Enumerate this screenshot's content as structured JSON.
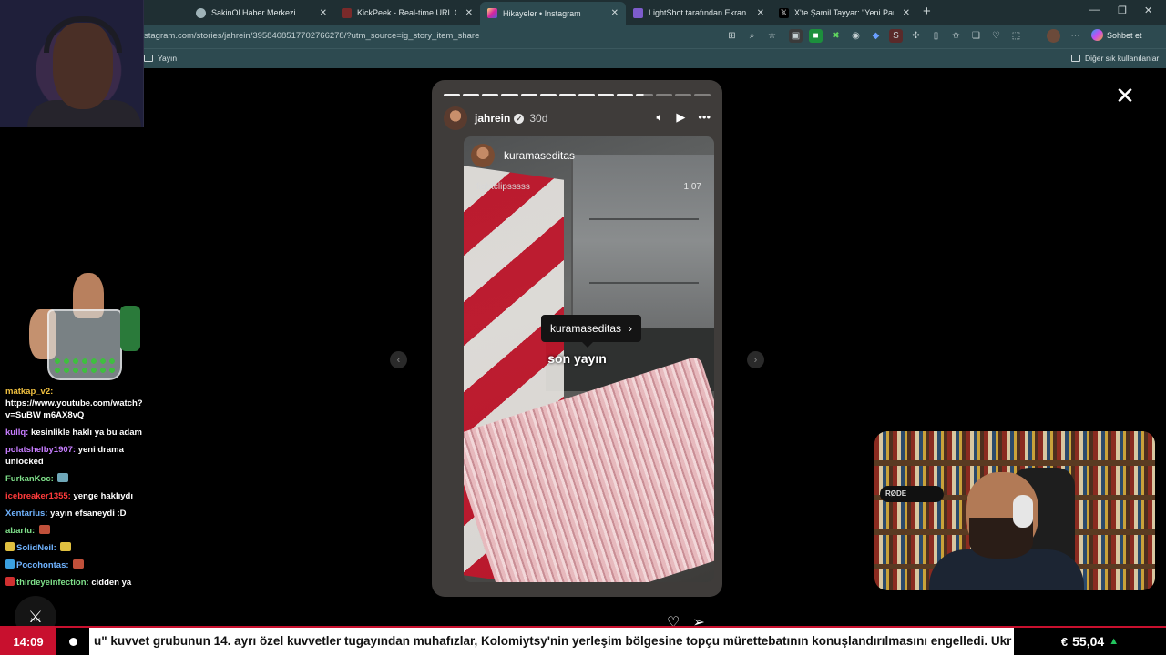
{
  "browser": {
    "tabs": [
      {
        "label": "SakinOl Haber Merkezi",
        "icon": "globe-icon",
        "color": "#9fb3b8"
      },
      {
        "label": "KickPeek - Real-time URL Crawler",
        "icon": "kickpeek-icon",
        "color": "#7a2a2a"
      },
      {
        "label": "Hikayeler • Instagram",
        "icon": "instagram-icon",
        "color": "#d6249f"
      },
      {
        "label": "LightShot tarafından Ekran Görüntüsü",
        "icon": "lightshot-icon",
        "color": "#7d5ccc"
      },
      {
        "label": "X'te Şamil Tayyar: \"Yeni Parti Genel",
        "icon": "x-icon",
        "color": "#000000"
      }
    ],
    "url": "stagram.com/stories/jahrein/3958408517702766278/?utm_source=ig_story_item_share",
    "bookmark_left": "Yayın",
    "bookmark_right": "Diğer sık kullanılanlar",
    "chat_button": "Sohbet et"
  },
  "story": {
    "username": "jahrein",
    "age": "30d",
    "verified_glyph": "✓",
    "progress_segments": 14,
    "progress_current_index": 10,
    "progress_current_fraction": 0.45,
    "inner_username": "kuramaseditas",
    "inner_subtitle": "fightclipsssss",
    "inner_duration": "1:07",
    "mention": "kuramaseditas",
    "caption": "son yayın"
  },
  "chat": [
    {
      "user": "matkap_v2",
      "color": "#f0c040",
      "text": "https://www.youtube.com/watch?v=SuBW m6AX8vQ",
      "badge": null,
      "emote": null
    },
    {
      "user": "kullq",
      "color": "#c77dff",
      "text": "kesinlikle haklı ya bu adam",
      "badge": null,
      "emote": null
    },
    {
      "user": "polatshelby1907",
      "color": "#c77dff",
      "text": "yeni drama unlocked",
      "badge": null,
      "emote": null
    },
    {
      "user": "FurkanKoc",
      "color": "#7fe08a",
      "text": "",
      "badge": null,
      "emote": "#6fa7b8"
    },
    {
      "user": "icebreaker1355",
      "color": "#ff3b3b",
      "text": "yenge haklıydı",
      "badge": null,
      "emote": null
    },
    {
      "user": "Xentarius",
      "color": "#6fb3ff",
      "text": "yayın efsaneydi :D",
      "badge": null,
      "emote": null
    },
    {
      "user": "abartu",
      "color": "#7fe08a",
      "text": "",
      "badge": null,
      "emote": "#c0503a"
    },
    {
      "user": "SolidNeil",
      "color": "#6fb3ff",
      "text": "",
      "badge": "#e0c040",
      "emote": "#e0c040"
    },
    {
      "user": "Pocohontas",
      "color": "#6fb3ff",
      "text": "",
      "badge": "#3aa0e0",
      "emote": "#c0503a"
    },
    {
      "user": "thirdeyeinfection",
      "color": "#7fe08a",
      "text": "cidden ya",
      "badge": "#d03030",
      "emote": null
    }
  ],
  "overlay": {
    "mic_label": "RØDE"
  },
  "ticker": {
    "time": "14:09",
    "headline": "u\" kuvvet grubunun 14. ayrı özel kuvvetler tugayından muhafızlar, Kolomiytsy'nin yerleşim bölgesine topçu mürettebatının konuşlandırılmasını engelledi. Ukr",
    "currency_symbol": "€",
    "rate": "55,04",
    "trend_glyph": "▲",
    "colors": {
      "accent": "#c8102e",
      "up": "#22c55e"
    }
  }
}
